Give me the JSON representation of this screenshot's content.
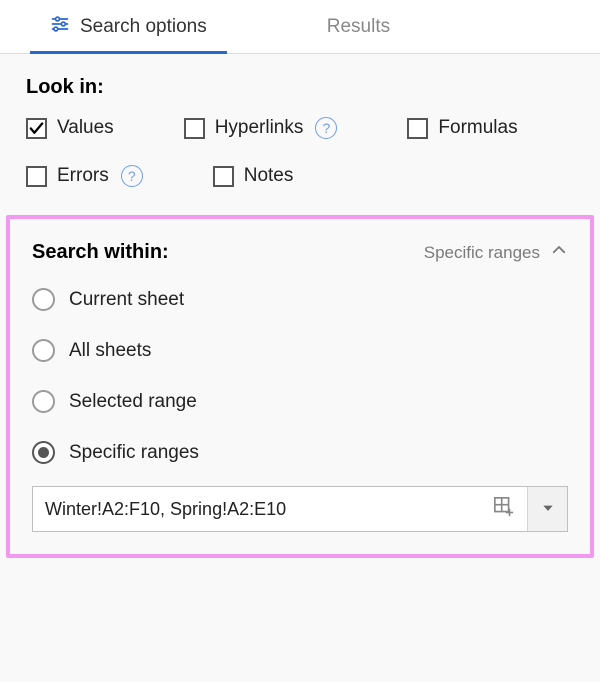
{
  "tabs": {
    "search_options": "Search options",
    "results": "Results"
  },
  "look_in": {
    "title": "Look in:",
    "values": "Values",
    "hyperlinks": "Hyperlinks",
    "formulas": "Formulas",
    "errors": "Errors",
    "notes": "Notes"
  },
  "search_within": {
    "title": "Search within:",
    "summary": "Specific ranges",
    "options": {
      "current_sheet": "Current sheet",
      "all_sheets": "All sheets",
      "selected_range": "Selected range",
      "specific_ranges": "Specific ranges"
    },
    "range_value": "Winter!A2:F10, Spring!A2:E10"
  }
}
